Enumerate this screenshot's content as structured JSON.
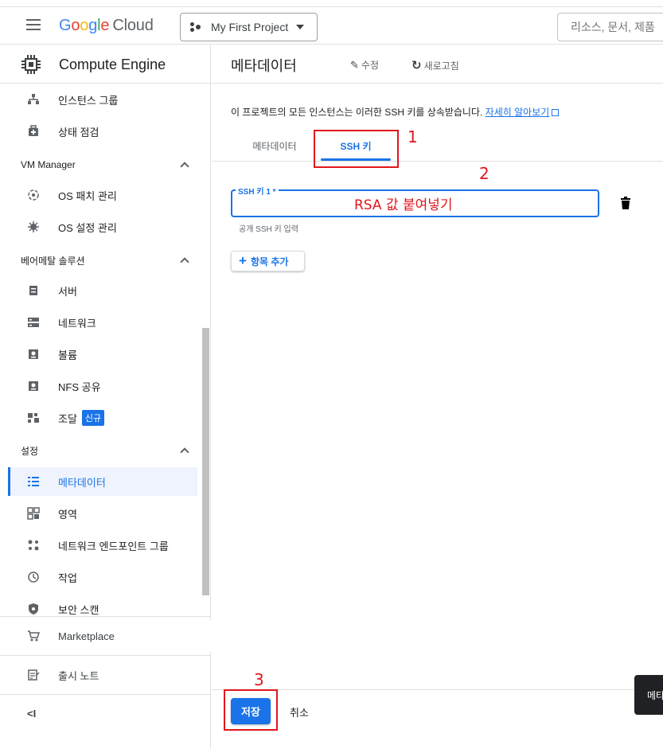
{
  "topbar": {
    "logo_google": [
      "G",
      "o",
      "o",
      "g",
      "l",
      "e"
    ],
    "logo_cloud": "Cloud",
    "project_name": "My First Project",
    "search_placeholder": "리소스, 문서, 제품"
  },
  "sidebar": {
    "product_title": "Compute Engine",
    "items_top": [
      {
        "label": "인스턴스 그룹",
        "icon": "instance-group-icon"
      },
      {
        "label": "상태 점검",
        "icon": "health-check-icon"
      }
    ],
    "section_vm_manager": "VM Manager",
    "items_vm": [
      {
        "label": "OS 패치 관리",
        "icon": "os-patch-icon"
      },
      {
        "label": "OS 설정 관리",
        "icon": "os-config-icon"
      }
    ],
    "section_baremetal": "베어메탈 솔루션",
    "items_bm": [
      {
        "label": "서버",
        "icon": "server-icon"
      },
      {
        "label": "네트워크",
        "icon": "network-icon"
      },
      {
        "label": "볼륨",
        "icon": "volume-icon"
      },
      {
        "label": "NFS 공유",
        "icon": "nfs-share-icon"
      },
      {
        "label": "조달",
        "icon": "procurement-icon",
        "badge": "신규"
      }
    ],
    "section_settings": "설정",
    "items_settings": [
      {
        "label": "메타데이터",
        "icon": "metadata-icon",
        "active": true
      },
      {
        "label": "영역",
        "icon": "zones-icon"
      },
      {
        "label": "네트워크 엔드포인트 그룹",
        "icon": "neg-icon"
      },
      {
        "label": "작업",
        "icon": "operations-icon"
      },
      {
        "label": "보안 스캔",
        "icon": "security-scan-icon"
      }
    ],
    "marketplace": "Marketplace",
    "release_notes": "출시 노트",
    "collapse_label": "<I"
  },
  "main": {
    "title": "메타데이터",
    "edit_label": "수정",
    "refresh_label": "새로고침",
    "description": "이 프로젝트의 모든 인스턴스는 이러한 SSH 키를 상속받습니다.",
    "learn_more": "자세히 알아보기",
    "tabs": [
      {
        "label": "메타데이터"
      },
      {
        "label": "SSH 키",
        "active": true
      }
    ],
    "ssh_field_label": "SSH 키 1 *",
    "ssh_field_help": "공개 SSH 키 입력",
    "add_item_label": "항목 추가",
    "save_label": "저장",
    "cancel_label": "취소",
    "toast_text": "메타"
  },
  "annotations": {
    "n1": "1",
    "n2": "2",
    "n3": "3",
    "field_note": "RSA 값 붙여넣기"
  },
  "colors": {
    "accent": "#1a73e8",
    "annotation_red": "#e0161c",
    "active_bg": "#eef3fd"
  }
}
